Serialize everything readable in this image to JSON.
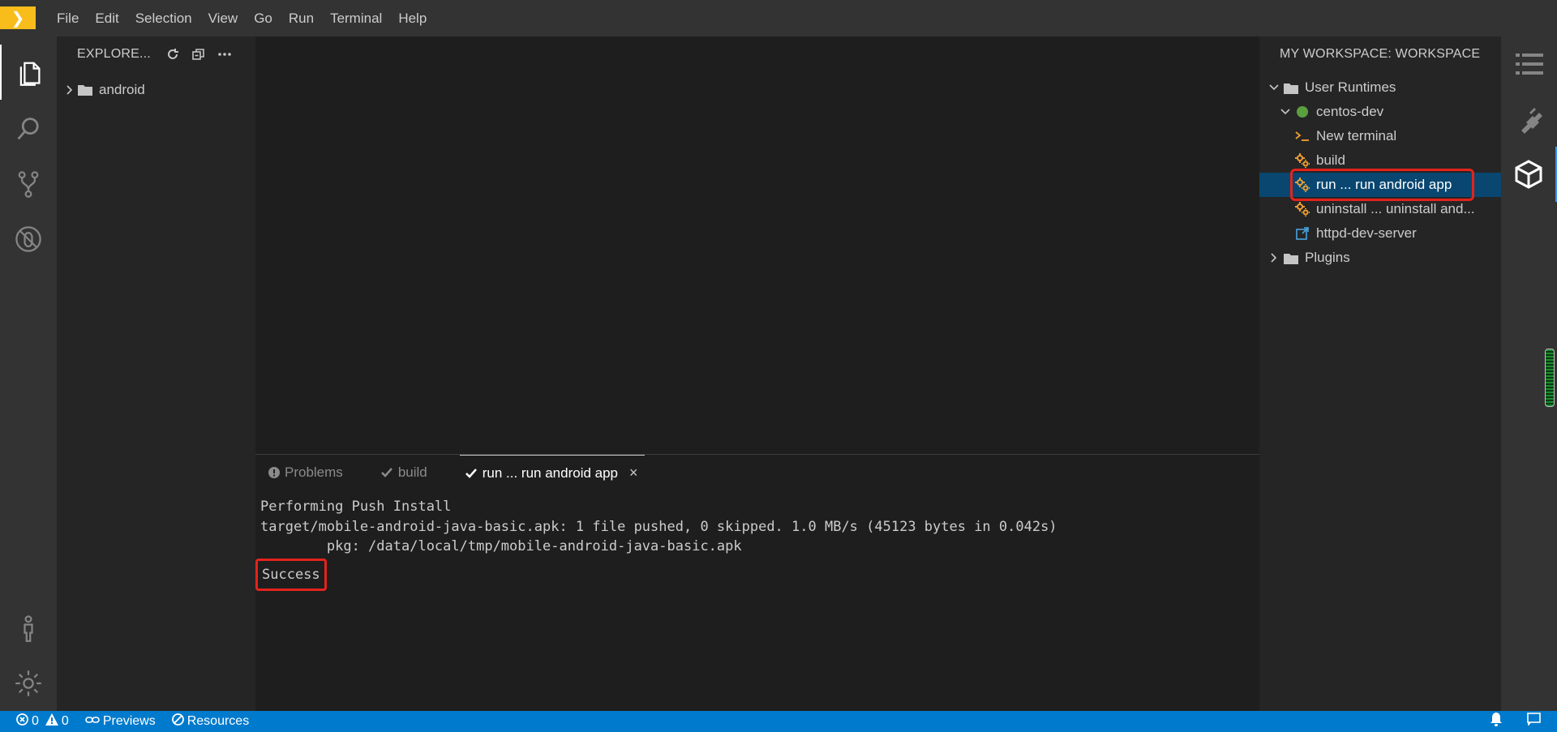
{
  "menu": {
    "logo_glyph": "❯",
    "items": [
      "File",
      "Edit",
      "Selection",
      "View",
      "Go",
      "Run",
      "Terminal",
      "Help"
    ]
  },
  "explorer": {
    "title": "EXPLORE...",
    "tree": [
      {
        "label": "android"
      }
    ]
  },
  "panel": {
    "tabs": [
      {
        "label": "Problems"
      },
      {
        "label": "build"
      },
      {
        "label": "run ... run android app",
        "close": "×"
      }
    ],
    "terminal_lines": [
      "Performing Push Install",
      "target/mobile-android-java-basic.apk: 1 file pushed, 0 skipped. 1.0 MB/s (45123 bytes in 0.042s)",
      "        pkg: /data/local/tmp/mobile-android-java-basic.apk"
    ],
    "terminal_result": "Success"
  },
  "workspace": {
    "title": "MY WORKSPACE: WORKSPACE",
    "user_runtimes": "User Runtimes",
    "runtime": "centos-dev",
    "items": {
      "new_terminal": "New terminal",
      "build": "build",
      "run": "run ... run android app",
      "uninstall": "uninstall ... uninstall and...",
      "httpd": "httpd-dev-server"
    },
    "plugins": "Plugins"
  },
  "statusbar": {
    "errors": "0",
    "warnings": "0",
    "previews": "Previews",
    "resources": "Resources"
  },
  "colors": {
    "accent": "#007acc",
    "selection": "#094771",
    "highlight": "#e3231c",
    "runtime_status": "#5ba03f",
    "logo": "#f8bd1b"
  }
}
